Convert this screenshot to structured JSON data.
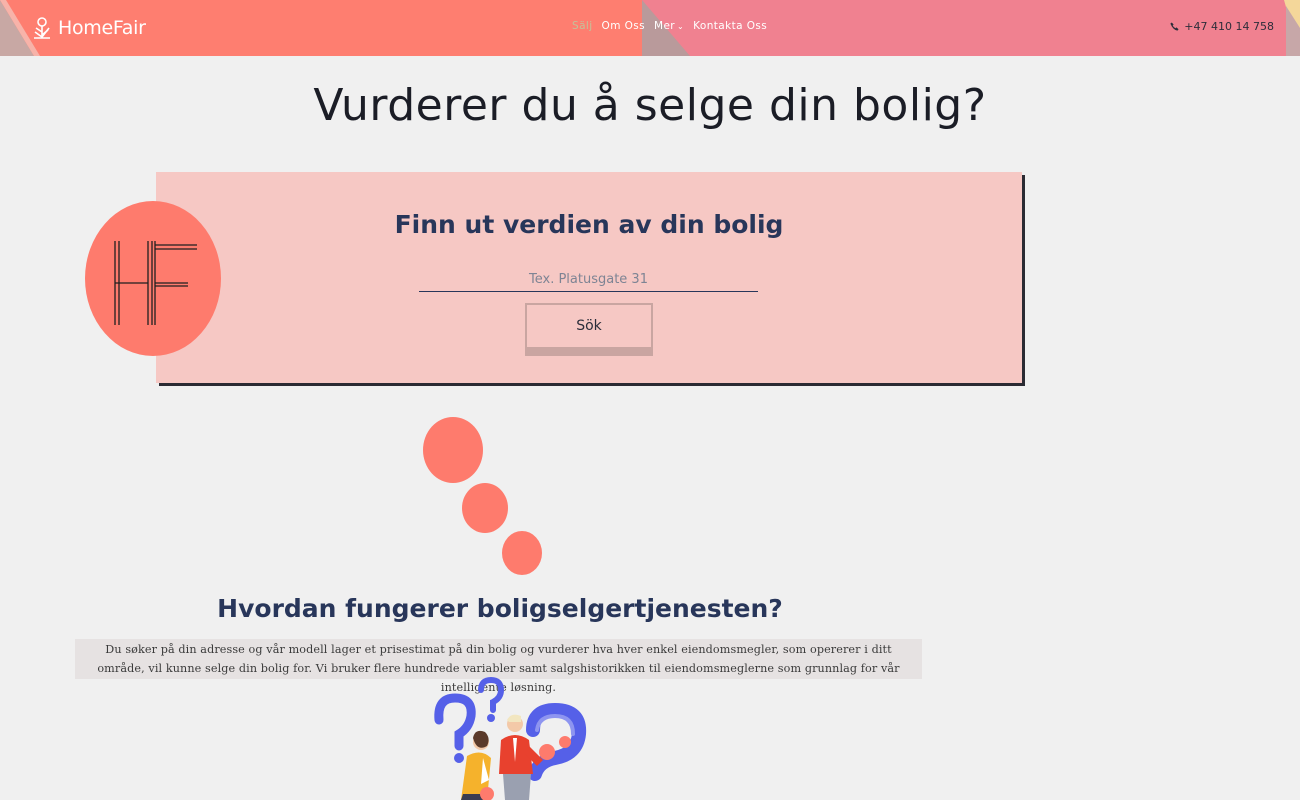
{
  "header": {
    "brand": "HomeFair",
    "nav": [
      {
        "label": "Sälj",
        "active": true
      },
      {
        "label": "Om Oss",
        "active": false
      },
      {
        "label": "Mer",
        "active": false
      },
      {
        "label": "Kontakta Oss",
        "active": false
      }
    ],
    "phone": "+47 410 14 758",
    "colors": {
      "coral": "#fe7b6d",
      "pink": "#f08190",
      "active_nav": "#c4c09a"
    }
  },
  "hero": {
    "title": "Vurderer du å selge din bolig?"
  },
  "valuation": {
    "title": "Finn ut verdien av din bolig",
    "input_placeholder": "Tex. Platusgate 31",
    "input_value": "",
    "button_label": "Sök",
    "badge_monogram": "HF",
    "colors": {
      "card": "#f6c8c4",
      "title": "#28365a",
      "badge": "#fe7b6d"
    }
  },
  "how_it_works": {
    "title": "Hvordan fungerer boligselgertjenesten?",
    "body": "Du søker på din adresse og vår modell lager et prisestimat på din bolig og vurderer hva hver enkel eiendomsmegler, som opererer i ditt område, vil kunne selge din bolig for. Vi bruker flere hundrede variabler samt salgshistorikken til eiendomsmeglerne som grunnlag for vår intelligente løsning."
  },
  "icons": [
    "sprout-logo-icon",
    "chevron-down-icon",
    "phone-icon",
    "hf-monogram-icon",
    "question-marks-illustration"
  ]
}
